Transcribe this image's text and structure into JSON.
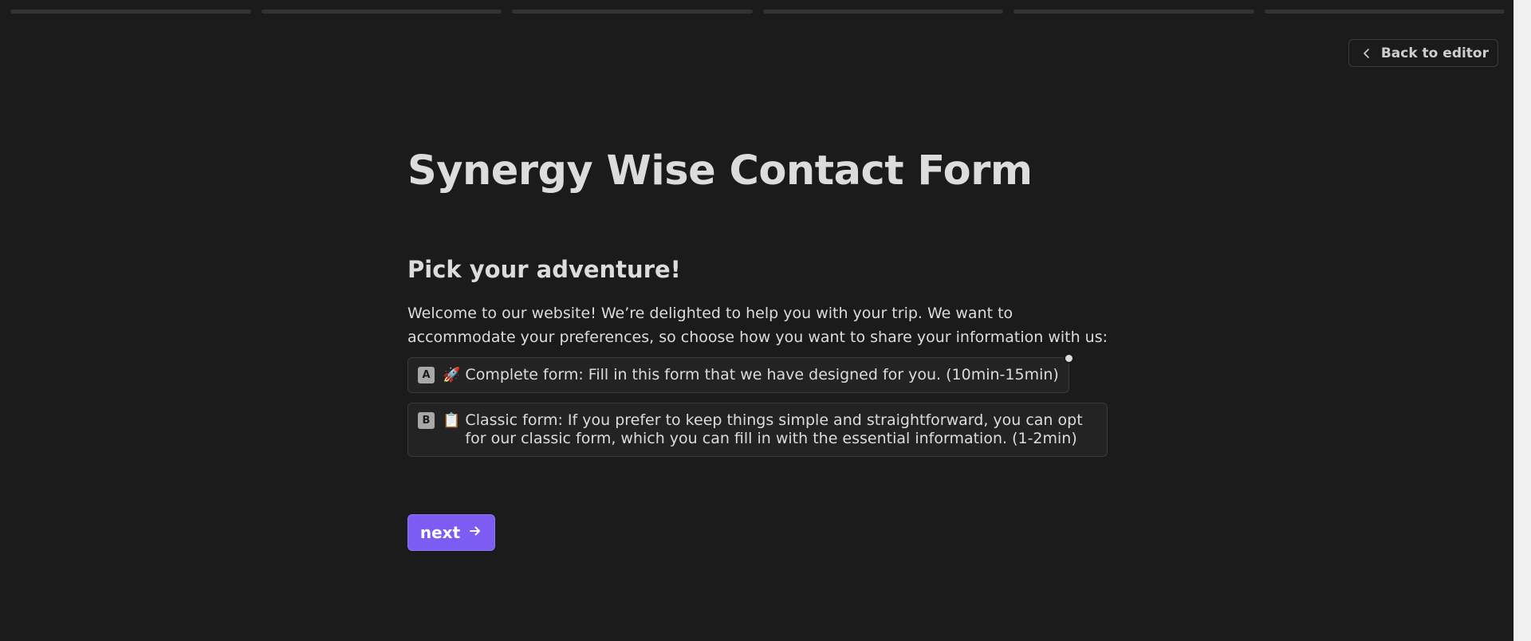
{
  "progress": {
    "segments": 6
  },
  "header": {
    "back_label": "Back to editor"
  },
  "form": {
    "title": "Synergy Wise Contact Form"
  },
  "question": {
    "title": "Pick your adventure!",
    "description": "Welcome to our website! We’re delighted to help you with your trip. We want to accommodate your preferences, so choose how you want to share your information with us:",
    "choices": [
      {
        "key": "A",
        "emoji": "🚀",
        "label": "Complete form: Fill in this form that we have designed for you. (10min-15min)"
      },
      {
        "key": "B",
        "emoji": "📋",
        "label": "Classic form: If you prefer to keep things simple and straightforward, you can opt for our classic form, which you can fill in with the essential information. (1-2min)"
      }
    ]
  },
  "next_button": {
    "label": "next"
  },
  "colors": {
    "background": "#1b1b1b",
    "accent": "#7c5cf2",
    "text": "#dcdcdc"
  }
}
